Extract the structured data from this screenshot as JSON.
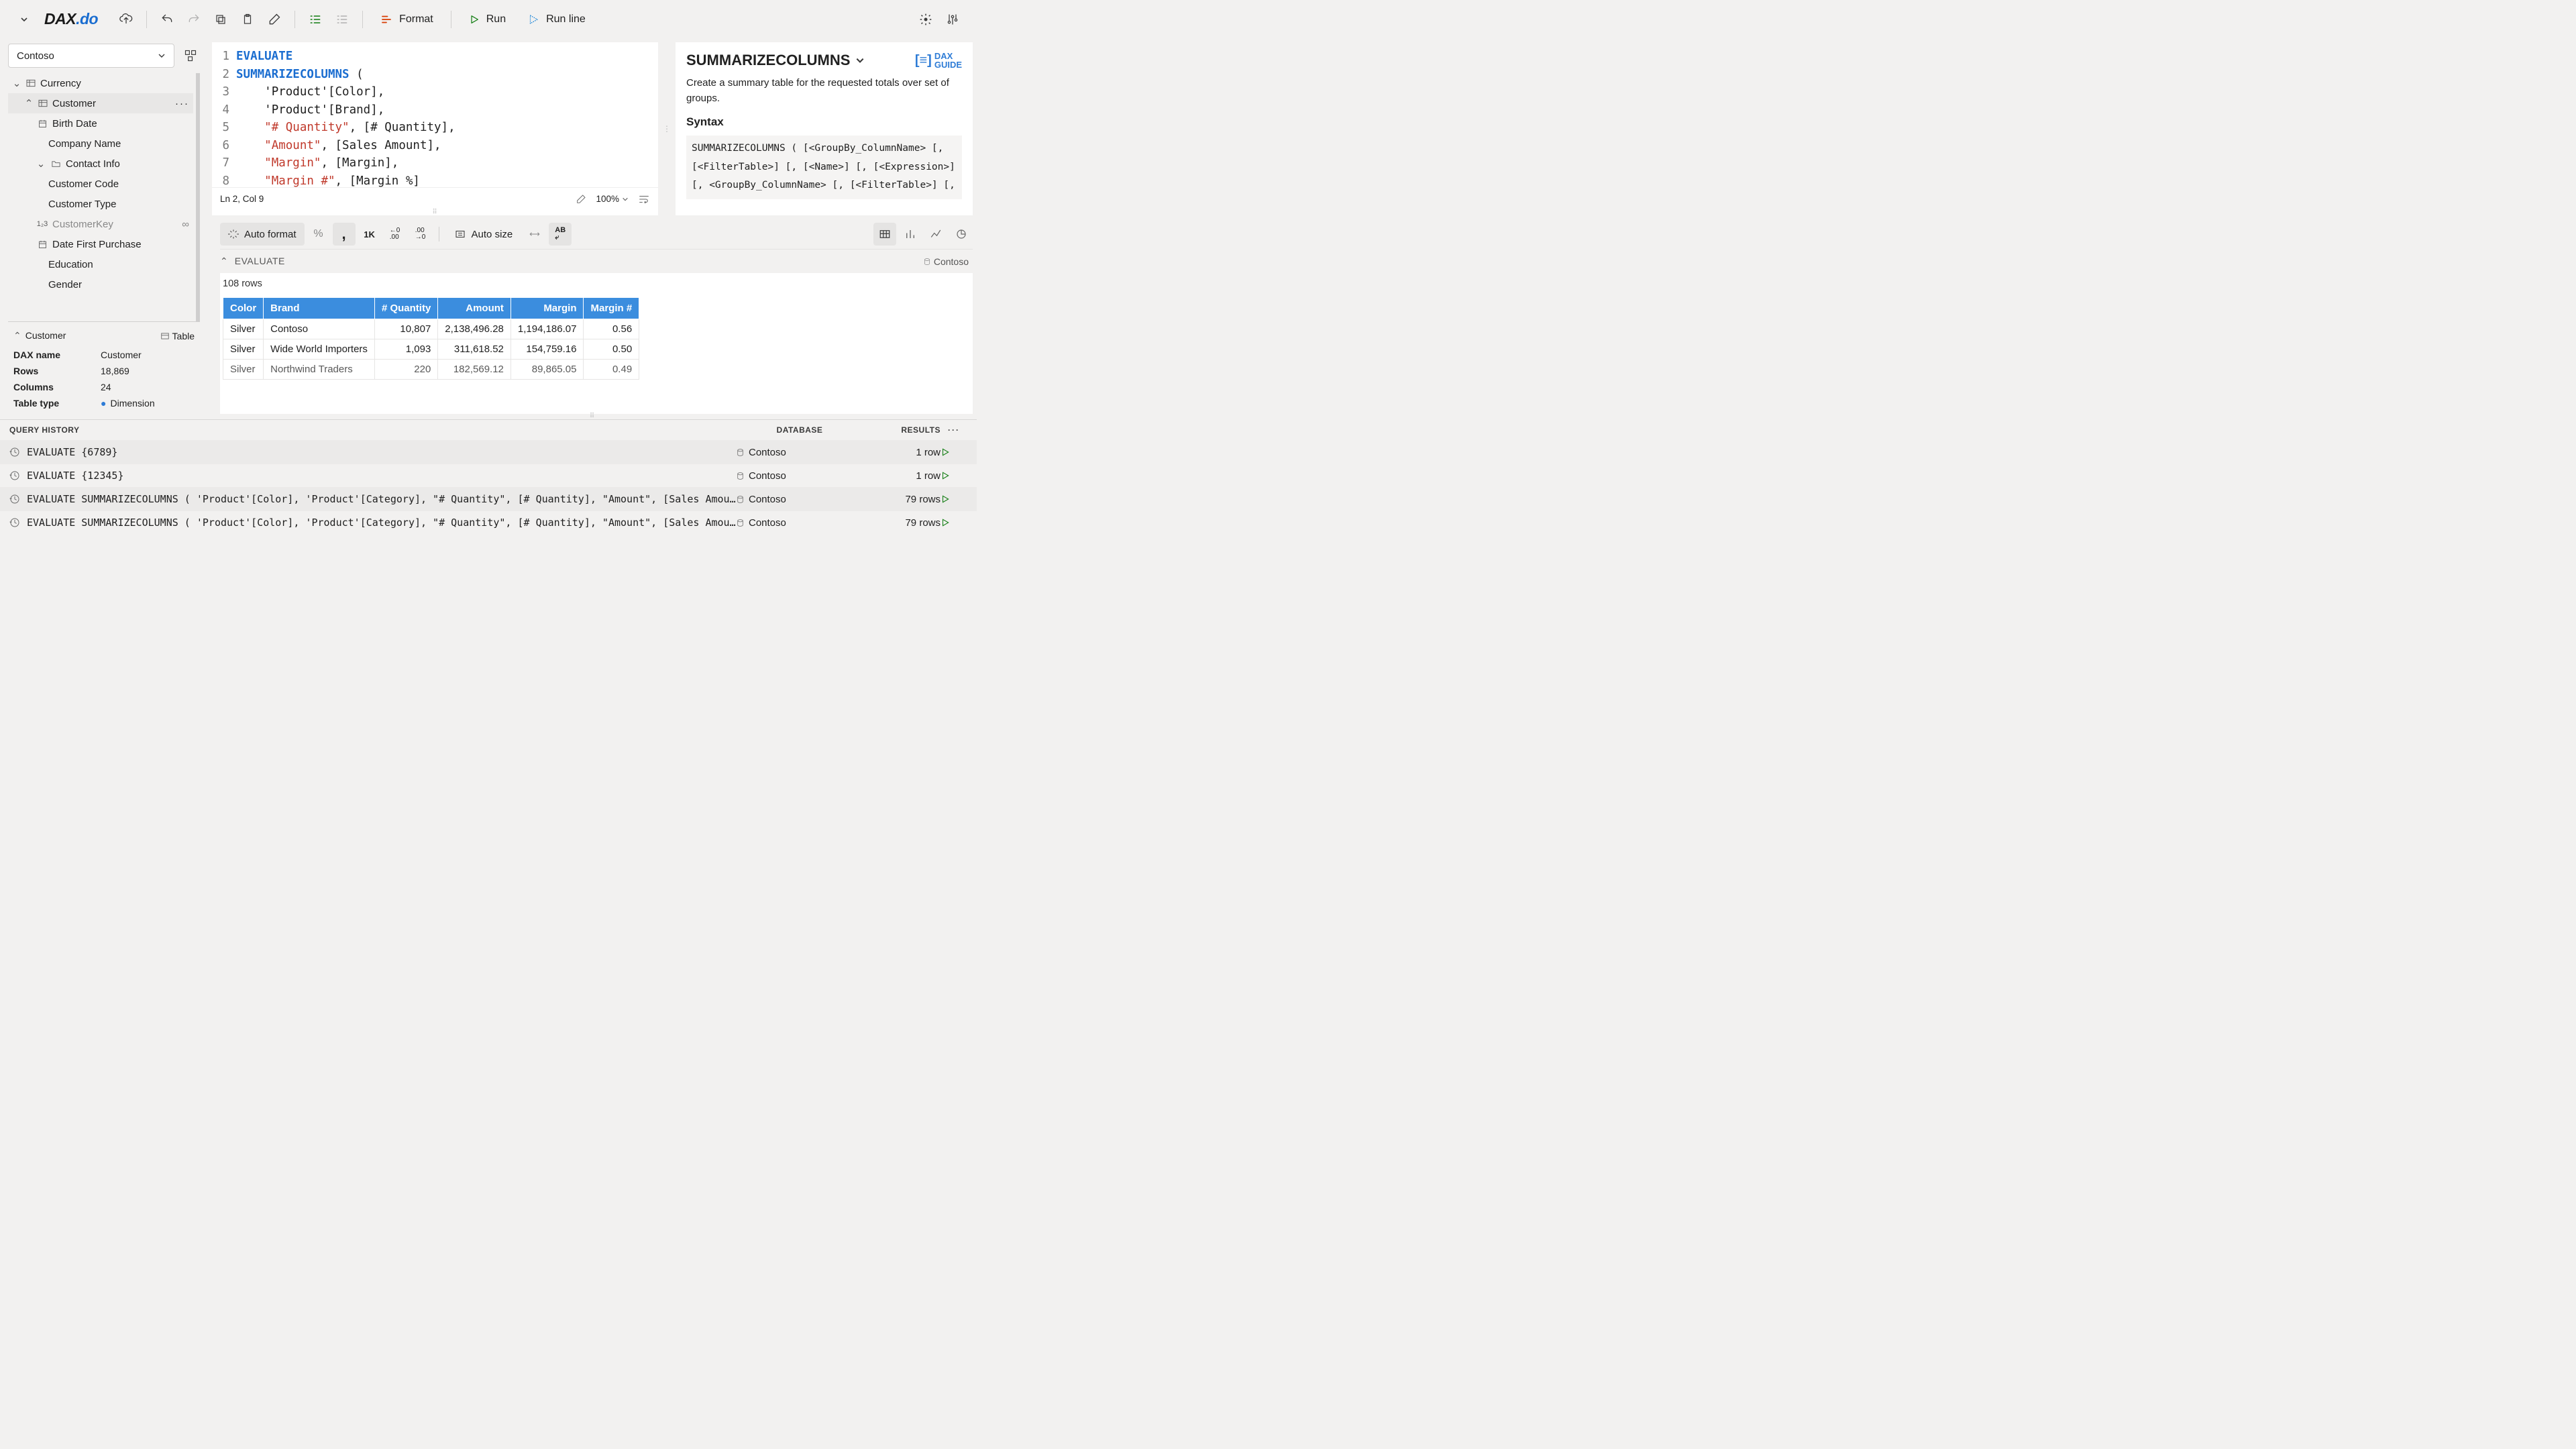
{
  "logo": {
    "left": "DAX",
    "right": ".do"
  },
  "toolbar": {
    "format": "Format",
    "run": "Run",
    "runline": "Run line"
  },
  "sidebar": {
    "model": "Contoso",
    "tree": {
      "currency": "Currency",
      "customer": "Customer",
      "cols": [
        "Birth Date",
        "Company Name",
        "Contact Info",
        "Customer Code",
        "Customer Type",
        "CustomerKey",
        "Date First Purchase",
        "Education",
        "Gender"
      ]
    },
    "props": {
      "title": "Customer",
      "typeLabel": "Table",
      "rows": [
        {
          "k": "DAX name",
          "v": "Customer"
        },
        {
          "k": "Rows",
          "v": "18,869"
        },
        {
          "k": "Columns",
          "v": "24"
        },
        {
          "k": "Table type",
          "v": "Dimension"
        }
      ]
    }
  },
  "editor": {
    "status": "Ln 2, Col 9",
    "zoom": "100%"
  },
  "doc": {
    "title": "SUMMARIZECOLUMNS",
    "guide": "DAX\nGUIDE",
    "desc": "Create a summary table for the requested totals over set of groups.",
    "syntaxLabel": "Syntax",
    "syntax": "SUMMARIZECOLUMNS ( [<GroupBy_ColumnName> [, [<FilterTable>] [, [<Name>] [, [<Expression>] [, <GroupBy_ColumnName> [, [<FilterTable>] [,"
  },
  "results": {
    "autoFormat": "Auto format",
    "autoSize": "Auto size",
    "evaluate": "EVALUATE",
    "db": "Contoso",
    "rowCount": "108 rows",
    "columns": [
      "Color",
      "Brand",
      "# Quantity",
      "Amount",
      "Margin",
      "Margin #"
    ],
    "rows": [
      [
        "Silver",
        "Contoso",
        "10,807",
        "2,138,496.28",
        "1,194,186.07",
        "0.56"
      ],
      [
        "Silver",
        "Wide World Importers",
        "1,093",
        "311,618.52",
        "154,759.16",
        "0.50"
      ],
      [
        "Silver",
        "Northwind Traders",
        "220",
        "182,569.12",
        "89,865.05",
        "0.49"
      ]
    ]
  },
  "history": {
    "heading": "QUERY HISTORY",
    "dbLabel": "DATABASE",
    "resLabel": "RESULTS",
    "items": [
      {
        "q": "EVALUATE {6789}",
        "db": "Contoso",
        "res": "1 row"
      },
      {
        "q": "EVALUATE {12345}",
        "db": "Contoso",
        "res": "1 row"
      },
      {
        "q": "EVALUATE SUMMARIZECOLUMNS ( 'Product'[Color], 'Product'[Category], \"# Quantity\", [# Quantity], \"Amount\", [Sales Amount…",
        "db": "Contoso",
        "res": "79 rows"
      },
      {
        "q": "EVALUATE SUMMARIZECOLUMNS ( 'Product'[Color], 'Product'[Category], \"# Quantity\", [# Quantity], \"Amount\", [Sales Amount…",
        "db": "Contoso",
        "res": "79 rows"
      }
    ]
  }
}
